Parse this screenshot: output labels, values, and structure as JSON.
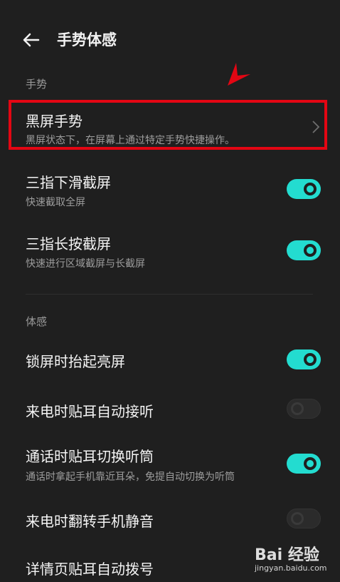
{
  "header": {
    "title": "手势体感",
    "back_icon": "back-arrow-icon"
  },
  "sections": {
    "gesture": {
      "label": "手势"
    },
    "motion": {
      "label": "体感"
    }
  },
  "rows": {
    "black_screen": {
      "title": "黑屏手势",
      "subtitle": "黑屏状态下，在屏幕上通过特定手势快捷操作。"
    },
    "three_finger_swipe": {
      "title": "三指下滑截屏",
      "subtitle": "快速截取全屏",
      "enabled": true
    },
    "three_finger_press": {
      "title": "三指长按截屏",
      "subtitle": "快速进行区域截屏与长截屏",
      "enabled": true
    },
    "lift_wake": {
      "title": "锁屏时抬起亮屏",
      "enabled": true
    },
    "auto_answer": {
      "title": "来电时贴耳自动接听",
      "enabled": false
    },
    "switch_earpiece": {
      "title": "通话时贴耳切换听筒",
      "subtitle": "通话时拿起手机靠近耳朵，免提自动切换为听筒",
      "enabled": true
    },
    "flip_mute": {
      "title": "来电时翻转手机静音",
      "enabled": false
    },
    "auto_dial": {
      "title": "详情页贴耳自动拨号",
      "enabled": false
    }
  },
  "watermark": {
    "logo": "Bai 经验",
    "url": "jingyan.baidu.com"
  },
  "colors": {
    "background": "#1f1f1f",
    "accent": "#23dcd0",
    "highlight": "#e30613"
  }
}
